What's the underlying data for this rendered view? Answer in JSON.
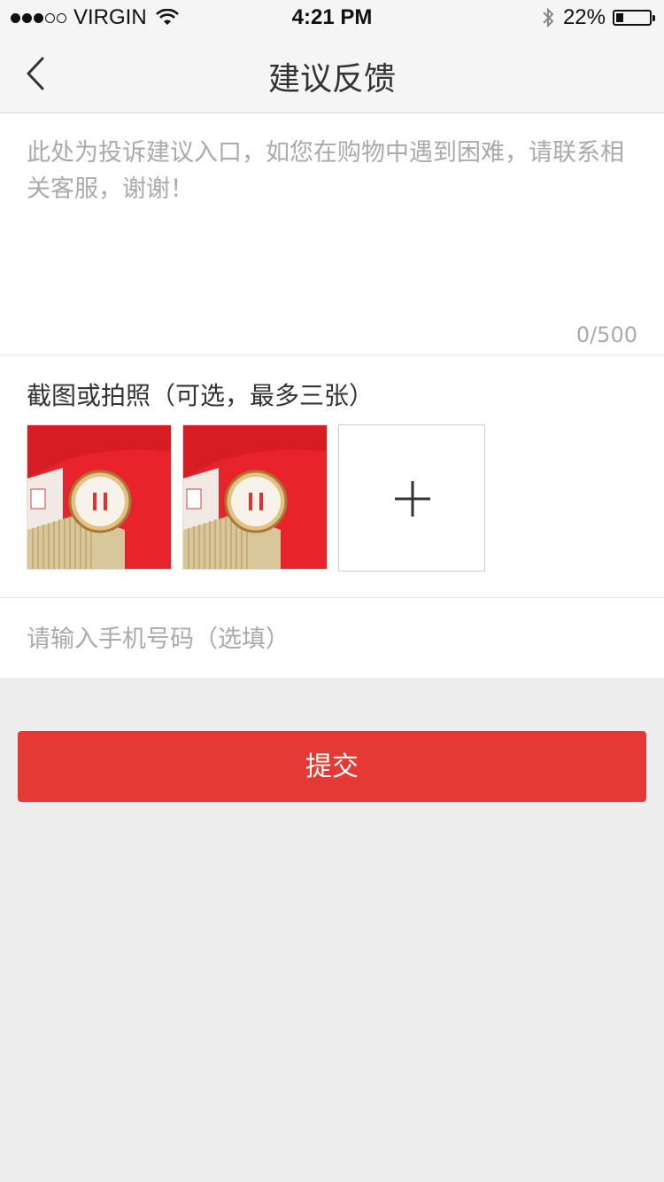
{
  "status_bar": {
    "carrier": "VIRGIN",
    "signal_bars_filled": 3,
    "signal_bars_total": 5,
    "time": "4:21 PM",
    "battery_percent_text": "22%",
    "battery_level": 0.22,
    "icons": [
      "wifi-icon",
      "bluetooth-icon",
      "battery-icon"
    ]
  },
  "nav": {
    "title": "建议反馈",
    "back_icon": "chevron-left-icon"
  },
  "feedback": {
    "placeholder": "此处为投诉建议入口，如您在购物中遇到困难，请联系相关客服，谢谢！",
    "char_count": "0/500"
  },
  "photos": {
    "label": "截图或拍照（可选，最多三张）",
    "add_icon": "plus-icon"
  },
  "phone": {
    "placeholder": "请输入手机号码（选填）"
  },
  "submit": {
    "label": "提交",
    "color": "#e53935"
  }
}
